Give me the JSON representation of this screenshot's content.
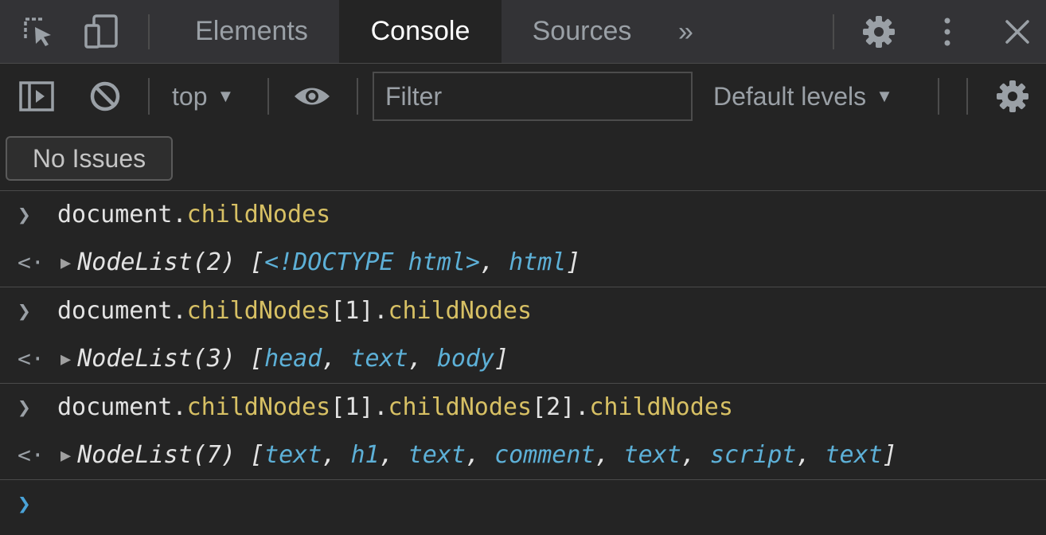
{
  "tabbar": {
    "tabs": [
      "Elements",
      "Console",
      "Sources"
    ],
    "active_tab": "Console",
    "more_tabs_label": "»",
    "icons": [
      "inspect-element-icon",
      "device-toolbar-icon",
      "settings-icon",
      "kebab-menu-icon",
      "close-icon"
    ]
  },
  "toolbar": {
    "context_label": "top",
    "filter_placeholder": "Filter",
    "levels_label": "Default levels",
    "icons": [
      "sidebar-toggle-icon",
      "clear-console-icon",
      "eye-icon",
      "settings-icon"
    ]
  },
  "issues": {
    "label": "No Issues"
  },
  "console": {
    "entries": [
      {
        "input": {
          "object": "document",
          "path": [
            ".",
            "childNodes"
          ]
        },
        "result": {
          "type": "NodeList(2)",
          "items": [
            "<!DOCTYPE html>",
            "html"
          ]
        }
      },
      {
        "input": {
          "object": "document",
          "path": [
            ".",
            "childNodes",
            "[1]",
            ".",
            "childNodes"
          ]
        },
        "result": {
          "type": "NodeList(3)",
          "items": [
            "head",
            "text",
            "body"
          ]
        }
      },
      {
        "input": {
          "object": "document",
          "path": [
            ".",
            "childNodes",
            "[1]",
            ".",
            "childNodes",
            "[2]",
            ".",
            "childNodes"
          ]
        },
        "result": {
          "type": "NodeList(7)",
          "items": [
            "text",
            "h1",
            "text",
            "comment",
            "text",
            "script",
            "text"
          ]
        }
      }
    ]
  },
  "colors": {
    "background": "#242424",
    "tabbar": "#333336",
    "property": "#d7c064",
    "node_item": "#5db0d7",
    "prompt_active": "#4aa3d8"
  }
}
